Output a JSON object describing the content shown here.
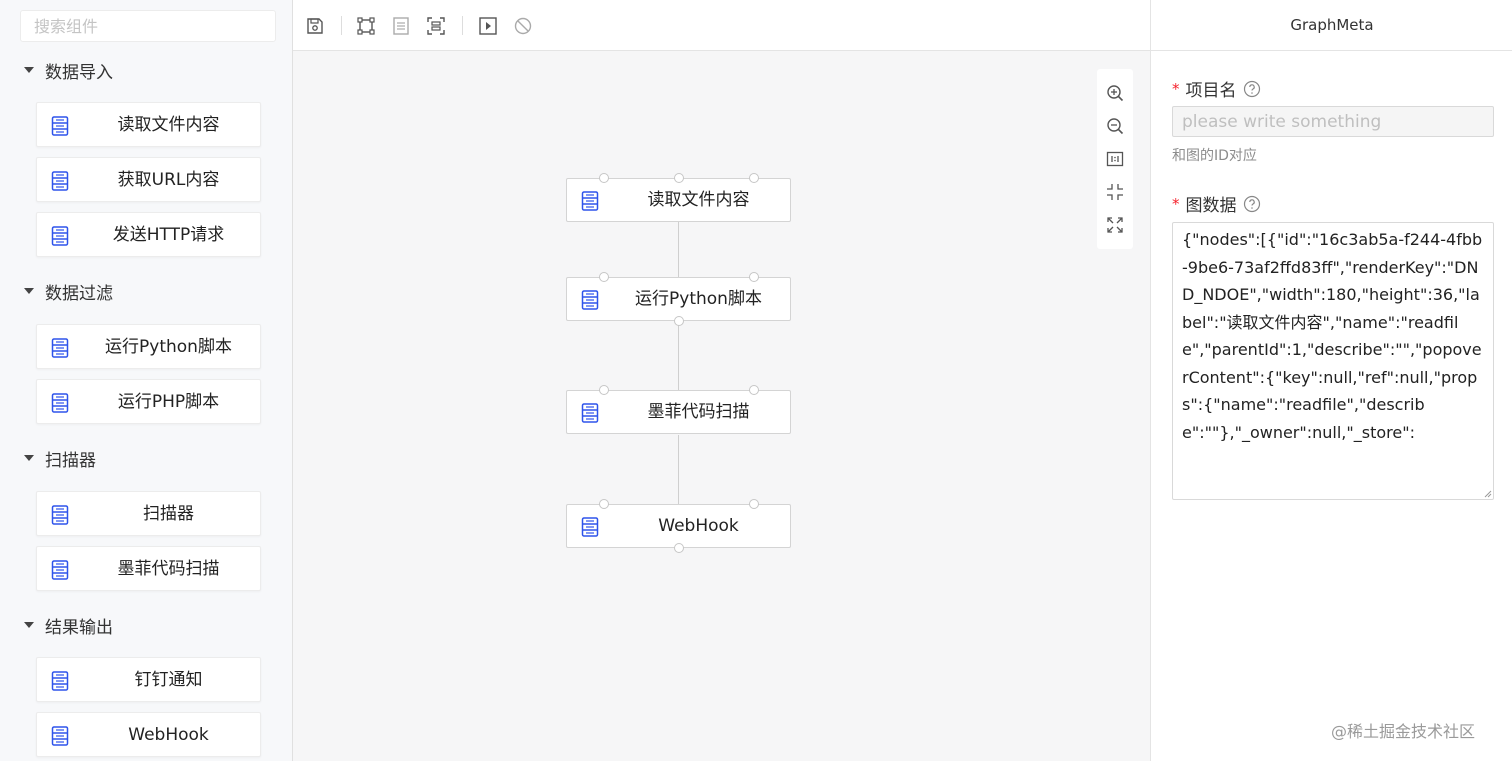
{
  "sidebar": {
    "search_placeholder": "搜索组件",
    "groups": [
      {
        "title": "数据导入",
        "items": [
          "读取文件内容",
          "获取URL内容",
          "发送HTTP请求"
        ]
      },
      {
        "title": "数据过滤",
        "items": [
          "运行Python脚本",
          "运行PHP脚本"
        ]
      },
      {
        "title": "扫描器",
        "items": [
          "扫描器",
          "墨菲代码扫描"
        ]
      },
      {
        "title": "结果输出",
        "items": [
          "钉钉通知",
          "WebHook"
        ]
      }
    ]
  },
  "toolbar": {
    "buttons": [
      "save-icon",
      "group-icon",
      "ungroup-icon",
      "select-all-icon",
      "run-icon",
      "stop-icon"
    ]
  },
  "canvas": {
    "nodes": [
      "读取文件内容",
      "运行Python脚本",
      "墨菲代码扫描",
      "WebHook"
    ],
    "zoom_buttons": [
      "zoom-in-icon",
      "zoom-out-icon",
      "actual-size-icon",
      "fit-screen-icon",
      "fullscreen-icon"
    ]
  },
  "panel": {
    "title": "GraphMeta",
    "field_project": {
      "label": "项目名",
      "required": "*",
      "placeholder": "please write something",
      "help": "和图的ID对应"
    },
    "field_graph": {
      "label": "图数据",
      "required": "*",
      "value": "{\"nodes\":[{\"id\":\"16c3ab5a-f244-4fbb-9be6-73af2ffd83ff\",\"renderKey\":\"DND_NDOE\",\"width\":180,\"height\":36,\"label\":\"读取文件内容\",\"name\":\"readfile\",\"parentId\":1,\"describe\":\"\",\"popoverContent\":{\"key\":null,\"ref\":null,\"props\":{\"name\":\"readfile\",\"describe\":\"\"},\"_owner\":null,\"_store\":"
    },
    "watermark": "@稀土掘金技术社区"
  },
  "colors": {
    "icon_blue": "#2f54eb",
    "required_red": "#f5222d"
  }
}
